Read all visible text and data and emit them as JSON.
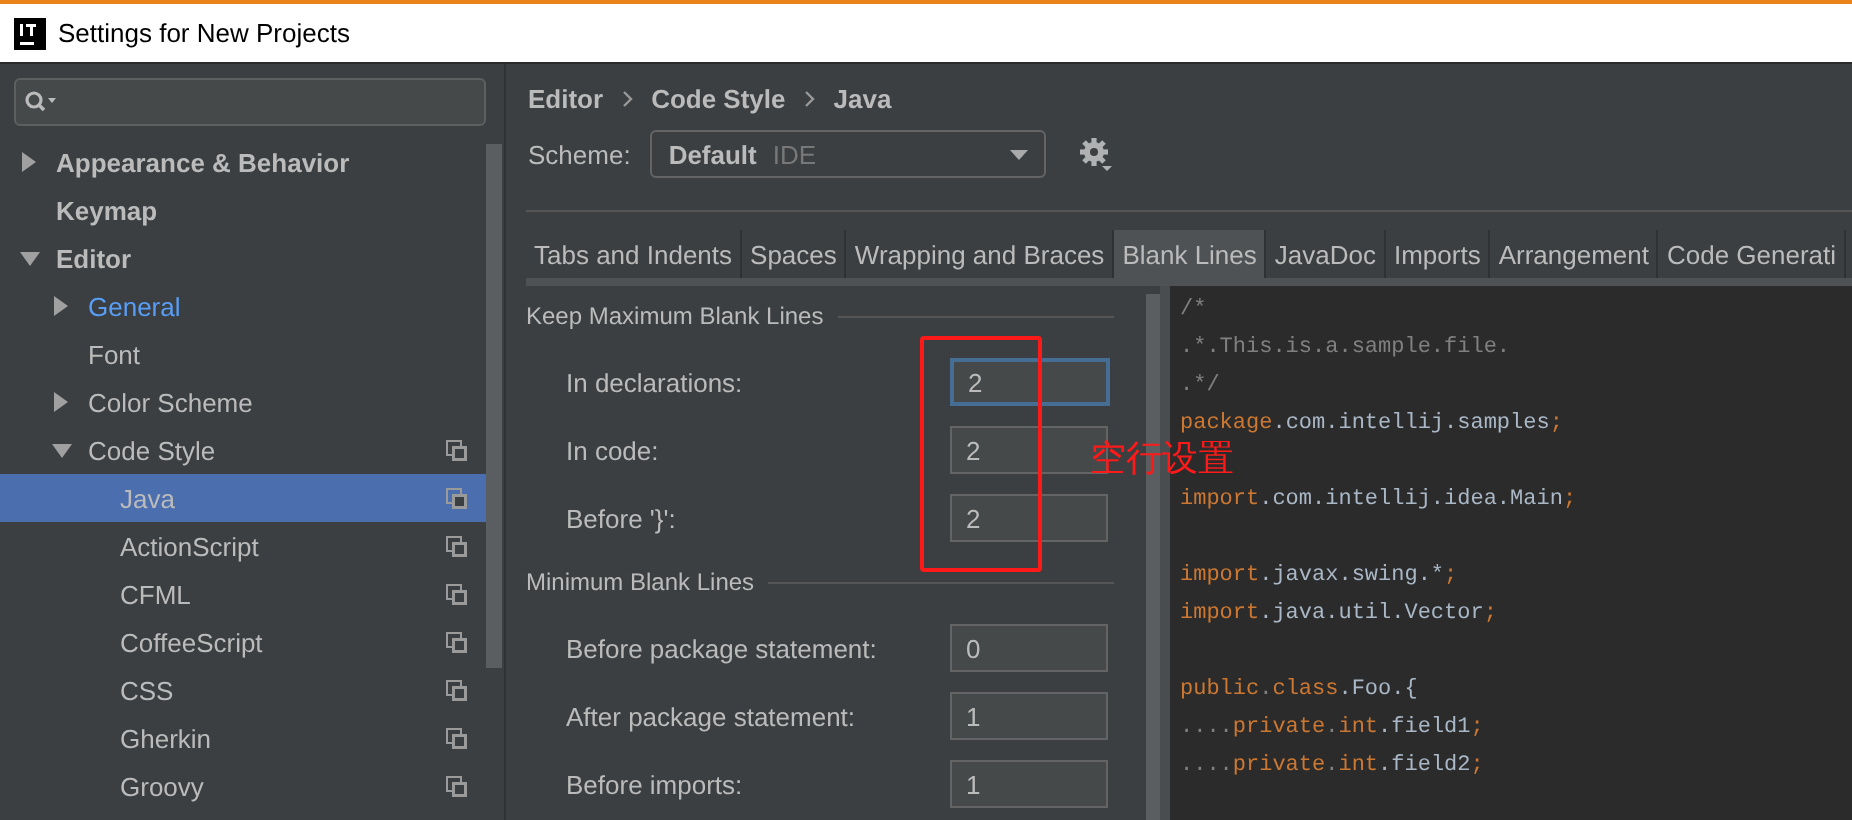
{
  "window": {
    "title": "Settings for New Projects"
  },
  "sidebar": {
    "tree": [
      {
        "label": "Appearance & Behavior",
        "expanded": false
      },
      {
        "label": "Keymap"
      },
      {
        "label": "Editor",
        "expanded": true,
        "children": [
          {
            "label": "General",
            "modified": true,
            "expanded": false
          },
          {
            "label": "Font"
          },
          {
            "label": "Color Scheme",
            "expanded": false
          },
          {
            "label": "Code Style",
            "expanded": true,
            "scheme_icon": true,
            "children": [
              {
                "label": "Java",
                "selected": true,
                "scheme_icon": true
              },
              {
                "label": "ActionScript",
                "selected": false,
                "scheme_icon": true
              },
              {
                "label": "CFML",
                "selected": false,
                "scheme_icon": true
              },
              {
                "label": "CoffeeScript",
                "selected": false,
                "scheme_icon": true
              },
              {
                "label": "CSS",
                "selected": false,
                "scheme_icon": true
              },
              {
                "label": "Gherkin",
                "selected": false,
                "scheme_icon": true
              },
              {
                "label": "Groovy",
                "selected": false,
                "scheme_icon": true
              }
            ]
          }
        ]
      }
    ]
  },
  "breadcrumb": [
    "Editor",
    "Code Style",
    "Java"
  ],
  "scheme": {
    "label": "Scheme:",
    "name": "Default",
    "tag": "IDE"
  },
  "tabs": [
    {
      "label": "Tabs and Indents",
      "selected": false
    },
    {
      "label": "Spaces",
      "selected": false
    },
    {
      "label": "Wrapping and Braces",
      "selected": false
    },
    {
      "label": "Blank Lines",
      "selected": true
    },
    {
      "label": "JavaDoc",
      "selected": false
    },
    {
      "label": "Imports",
      "selected": false
    },
    {
      "label": "Arrangement",
      "selected": false
    },
    {
      "label": "Code Generati",
      "selected": false
    }
  ],
  "sections": [
    {
      "title": "Keep Maximum Blank Lines",
      "rows": [
        {
          "label": "In declarations:",
          "value": "2",
          "focused": true
        },
        {
          "label": "In code:",
          "value": "2",
          "focused": false
        },
        {
          "label": "Before '}':",
          "value": "2",
          "focused": false
        }
      ]
    },
    {
      "title": "Minimum Blank Lines",
      "rows": [
        {
          "label": "Before package statement:",
          "value": "0",
          "focused": false
        },
        {
          "label": "After package statement:",
          "value": "1",
          "focused": false
        },
        {
          "label": "Before imports:",
          "value": "1",
          "focused": false
        }
      ]
    }
  ],
  "annotation": {
    "text": "空行设置"
  },
  "code": [
    {
      "kind": "code",
      "tokens": [
        {
          "kind": "comment",
          "text": "/*"
        }
      ]
    },
    {
      "kind": "code",
      "tokens": [
        {
          "kind": "comment",
          "text": ".*.This.is.a.sample.file."
        }
      ]
    },
    {
      "kind": "code",
      "tokens": [
        {
          "kind": "comment",
          "text": ".*/"
        }
      ]
    },
    {
      "kind": "code",
      "tokens": [
        {
          "kind": "keyword",
          "text": "package"
        },
        {
          "kind": "plain",
          "text": ".com.intellij.samples"
        },
        {
          "kind": "keyword",
          "text": ";"
        }
      ]
    },
    {
      "kind": "blank"
    },
    {
      "kind": "code",
      "tokens": [
        {
          "kind": "keyword",
          "text": "import"
        },
        {
          "kind": "plain",
          "text": ".com.intellij.idea.Main"
        },
        {
          "kind": "keyword",
          "text": ";"
        }
      ]
    },
    {
      "kind": "blank"
    },
    {
      "kind": "code",
      "tokens": [
        {
          "kind": "keyword",
          "text": "import"
        },
        {
          "kind": "plain",
          "text": ".javax.swing.*"
        },
        {
          "kind": "keyword",
          "text": ";"
        }
      ]
    },
    {
      "kind": "code",
      "tokens": [
        {
          "kind": "keyword",
          "text": "import"
        },
        {
          "kind": "plain",
          "text": ".java.util.Vector"
        },
        {
          "kind": "keyword",
          "text": ";"
        }
      ]
    },
    {
      "kind": "blank"
    },
    {
      "kind": "code",
      "tokens": [
        {
          "kind": "keyword",
          "text": "public"
        },
        {
          "kind": "comment",
          "text": "."
        },
        {
          "kind": "keyword",
          "text": "class"
        },
        {
          "kind": "plain",
          "text": ".Foo.{"
        }
      ]
    },
    {
      "kind": "code",
      "tokens": [
        {
          "kind": "comment",
          "text": "...."
        },
        {
          "kind": "keyword",
          "text": "private"
        },
        {
          "kind": "comment",
          "text": "."
        },
        {
          "kind": "keyword",
          "text": "int"
        },
        {
          "kind": "plain",
          "text": ".field1"
        },
        {
          "kind": "keyword",
          "text": ";"
        }
      ]
    },
    {
      "kind": "code",
      "tokens": [
        {
          "kind": "comment",
          "text": "...."
        },
        {
          "kind": "keyword",
          "text": "private"
        },
        {
          "kind": "comment",
          "text": "."
        },
        {
          "kind": "keyword",
          "text": "int"
        },
        {
          "kind": "plain",
          "text": ".field2"
        },
        {
          "kind": "keyword",
          "text": ";"
        }
      ]
    }
  ]
}
